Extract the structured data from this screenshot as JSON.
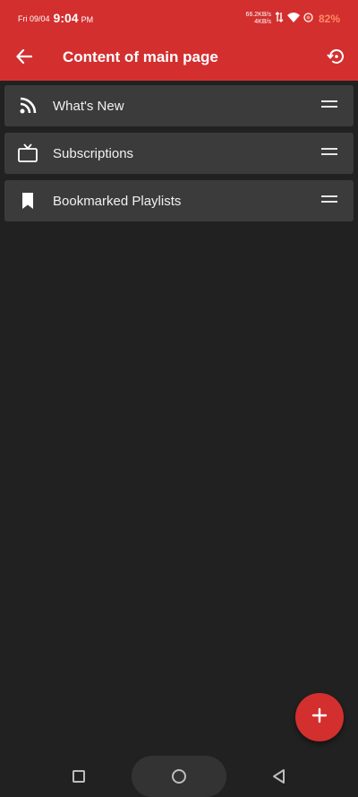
{
  "status_bar": {
    "date": "Fri 09/04",
    "time": "9:04",
    "ampm": "PM",
    "speed_up": "66.2KB/s",
    "speed_down": "4KB/s",
    "battery": "82%"
  },
  "app_bar": {
    "title": "Content of main page",
    "back_icon": "arrow-back-icon",
    "reset_icon": "restore-icon"
  },
  "items": [
    {
      "label": "What's New",
      "icon": "rss-feed-icon"
    },
    {
      "label": "Subscriptions",
      "icon": "tv-icon"
    },
    {
      "label": "Bookmarked Playlists",
      "icon": "bookmark-icon"
    }
  ],
  "fab": {
    "icon": "add-icon"
  },
  "colors": {
    "accent": "#d32f2f",
    "background": "#212121",
    "item_background": "#3b3b3b",
    "battery": "#ff8a65"
  }
}
